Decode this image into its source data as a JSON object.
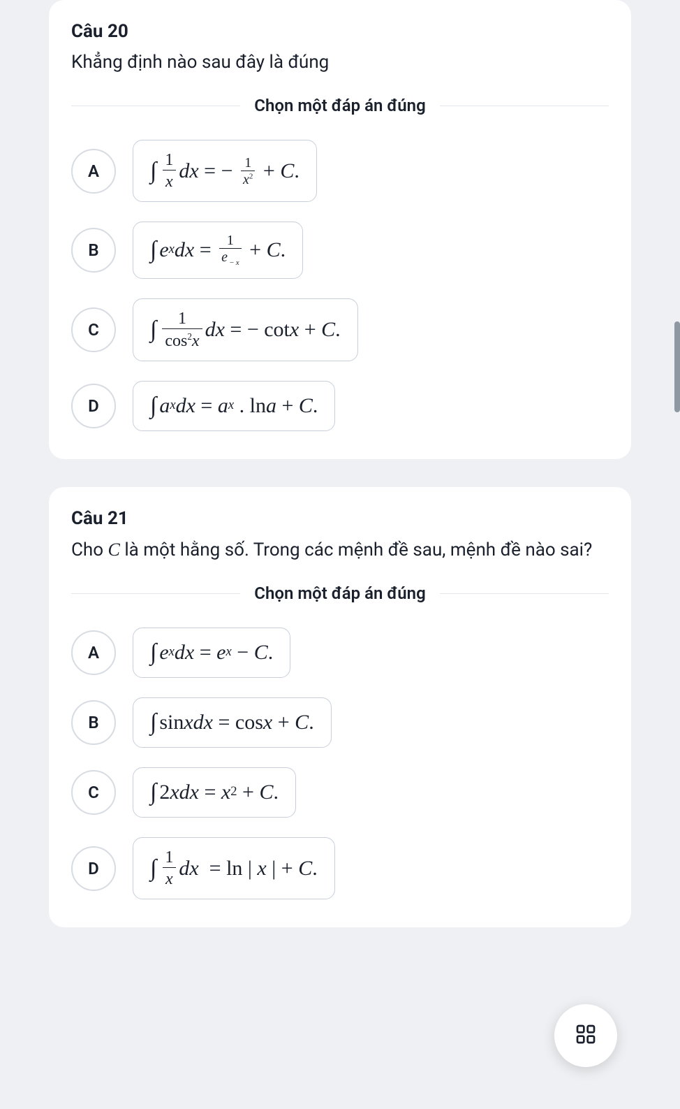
{
  "questions": [
    {
      "title": "Câu 20",
      "text": "Khẳng định nào sau đây là đúng",
      "instruction": "Chọn một đáp án đúng",
      "options": [
        {
          "letter": "A",
          "formula_key": "q20_a"
        },
        {
          "letter": "B",
          "formula_key": "q20_b"
        },
        {
          "letter": "C",
          "formula_key": "q20_c"
        },
        {
          "letter": "D",
          "formula_key": "q20_d"
        }
      ]
    },
    {
      "title": "Câu 21",
      "text_parts": {
        "pre": "Cho ",
        "var": "C",
        "post": " là một hằng số. Trong các mệnh đề sau, mệnh đề nào sai?"
      },
      "instruction": "Chọn một đáp án đúng",
      "options": [
        {
          "letter": "A",
          "formula_key": "q21_a"
        },
        {
          "letter": "B",
          "formula_key": "q21_b"
        },
        {
          "letter": "C",
          "formula_key": "q21_c"
        },
        {
          "letter": "D",
          "formula_key": "q21_d"
        }
      ]
    }
  ],
  "formulas": {
    "q20_a": "∫ (1/x) dx = − 1/x² + C.",
    "q20_b": "∫ eˣ dx = 1/e⁻ˣ + C.",
    "q20_c": "∫ (1/cos²x) dx = − cotx + C.",
    "q20_d": "∫ aˣ dx = aˣ · ln a + C.",
    "q21_a": "∫ eˣ dx = eˣ − C.",
    "q21_b": "∫ sinx dx = cosx + C.",
    "q21_c": "∫ 2x dx = x² + C.",
    "q21_d": "∫ (1/x) dx = ln|x| + C."
  },
  "fab_icon": "grid-icon"
}
